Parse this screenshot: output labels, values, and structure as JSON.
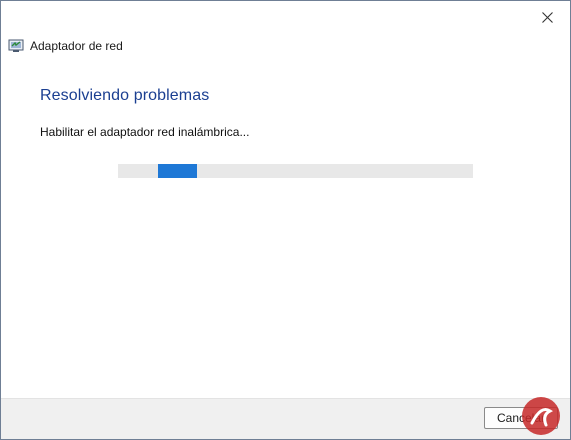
{
  "window": {
    "title": "Adaptador de red",
    "icon": "network-troubleshooter-icon",
    "close_icon": "close-icon"
  },
  "main": {
    "heading": "Resolviendo problemas",
    "status_text": "Habilitar el adaptador red inalámbrica...",
    "progress": {
      "state": "indeterminate",
      "segment_color": "#1e78d6",
      "track_color": "#e8e8e8"
    }
  },
  "footer": {
    "cancel_label": "Cancelar"
  },
  "colors": {
    "heading": "#1b3f91",
    "accent": "#1e78d6"
  }
}
